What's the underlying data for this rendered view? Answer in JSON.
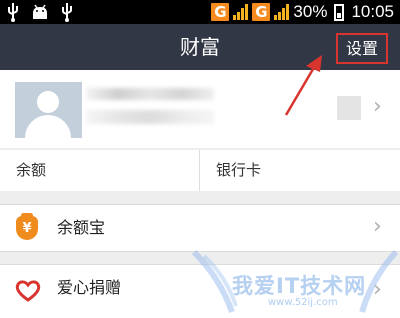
{
  "status_bar": {
    "left_icons": [
      "usb-icon",
      "android-debug-icon",
      "usb-icon"
    ],
    "network_1": "G",
    "network_2": "G",
    "battery_percent": "30%",
    "time": "10:05"
  },
  "header": {
    "title": "财富",
    "settings_label": "设置"
  },
  "profile": {
    "avatar_icon": "default-avatar-icon"
  },
  "quick_links": {
    "balance_label": "余额",
    "bank_card_label": "银行卡"
  },
  "list": [
    {
      "label": "余额宝",
      "icon": "yuebao-icon",
      "icon_glyph": "¥"
    },
    {
      "label": "爱心捐赠",
      "icon": "heart-icon"
    }
  ],
  "watermark": {
    "text": "我爱IT技术网",
    "url": "www.52ij.com"
  },
  "colors": {
    "title_bar": "#313744",
    "accent_orange": "#f08b1d",
    "heart_red": "#d8352e",
    "annotation_red": "#d8352e"
  }
}
